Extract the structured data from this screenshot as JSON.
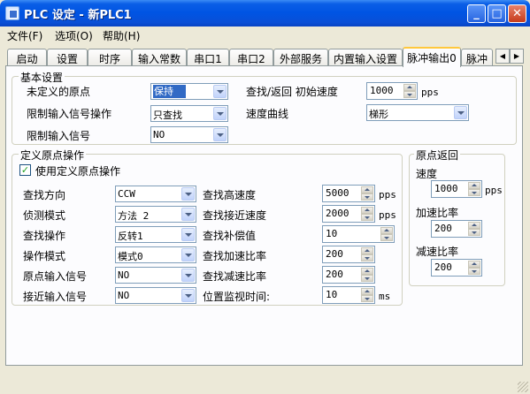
{
  "window": {
    "title": "PLC 设定 - 新PLC1",
    "min_glyph": "_",
    "max_glyph": "□",
    "close_glyph": "✕"
  },
  "menu": [
    "文件(F)",
    "选项(O)",
    "帮助(H)"
  ],
  "tabs": [
    "启动",
    "设置",
    "时序",
    "输入常数",
    "串口1",
    "串口2",
    "外部服务",
    "内置输入设置",
    "脉冲输出0",
    "脉冲"
  ],
  "active_tab_index": 8,
  "tab_scroll": {
    "left": "◀",
    "right": "▶"
  },
  "basic": {
    "title": "基本设置",
    "undefined_origin_label": "未定义的原点",
    "undefined_origin_value": "保持",
    "limit_op_label": "限制输入信号操作",
    "limit_op_value": "只查找",
    "limit_signal_label": "限制输入信号",
    "limit_signal_value": "NO",
    "search_return_speed_label": "查找/返回 初始速度",
    "search_return_speed_value": "1000",
    "search_return_speed_unit": "pps",
    "speed_curve_label": "速度曲线",
    "speed_curve_value": "梯形"
  },
  "origin_op": {
    "title": "定义原点操作",
    "use_label": "使用定义原点操作",
    "use_checked": "✓",
    "rows_left": [
      {
        "label": "查找方向",
        "value": "CCW"
      },
      {
        "label": "侦测模式",
        "value": "方法 2"
      },
      {
        "label": "查找操作",
        "value": "反转1"
      },
      {
        "label": "操作模式",
        "value": "模式0"
      },
      {
        "label": "原点输入信号",
        "value": "NO"
      },
      {
        "label": "接近输入信号",
        "value": "NO"
      }
    ],
    "rows_right": [
      {
        "label": "查找高速度",
        "value": "5000",
        "unit": "pps"
      },
      {
        "label": "查找接近速度",
        "value": "2000",
        "unit": "pps"
      },
      {
        "label": "查找补偿值",
        "value": "10",
        "unit": ""
      },
      {
        "label": "查找加速比率",
        "value": "200",
        "unit": ""
      },
      {
        "label": "查找减速比率",
        "value": "200",
        "unit": ""
      },
      {
        "label": "位置监视时间:",
        "value": "10",
        "unit": "ms"
      }
    ]
  },
  "origin_return": {
    "title": "原点返回",
    "speed_label": "速度",
    "speed_value": "1000",
    "speed_unit": "pps",
    "accel_label": "加速比率",
    "accel_value": "200",
    "decel_label": "减速比率",
    "decel_value": "200"
  },
  "colors": {
    "titlebar": "#0054e3",
    "face": "#ece9d8",
    "tab_highlight": "#ffc83c",
    "selection": "#316ac5"
  }
}
